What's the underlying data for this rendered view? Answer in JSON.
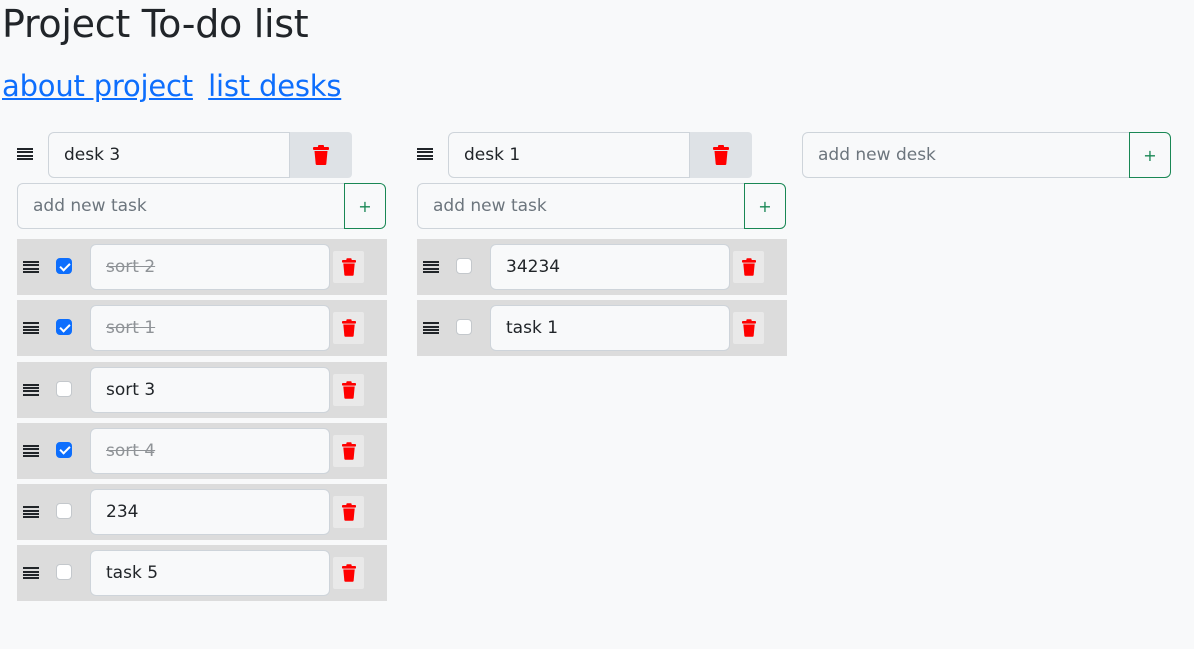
{
  "header": {
    "title": "Project To-do list",
    "links": [
      "about project",
      "list desks"
    ]
  },
  "desks": [
    {
      "name": "desk 3",
      "add_task_placeholder": "add new task",
      "add_task_button": "+",
      "tasks": [
        {
          "text": "sort 2",
          "done": true
        },
        {
          "text": "sort 1",
          "done": true
        },
        {
          "text": "sort 3",
          "done": false
        },
        {
          "text": "sort 4",
          "done": true
        },
        {
          "text": "234",
          "done": false
        },
        {
          "text": "task 5",
          "done": false
        }
      ]
    },
    {
      "name": "desk 1",
      "add_task_placeholder": "add new task",
      "add_task_button": "+",
      "tasks": [
        {
          "text": "34234",
          "done": false
        },
        {
          "text": "task 1",
          "done": false
        }
      ]
    }
  ],
  "new_desk": {
    "placeholder": "add new desk",
    "button": "+"
  },
  "colors": {
    "link": "#0d6efd",
    "danger": "#ff0000",
    "success": "#198754",
    "checkbox_checked": "#0d6efd"
  }
}
